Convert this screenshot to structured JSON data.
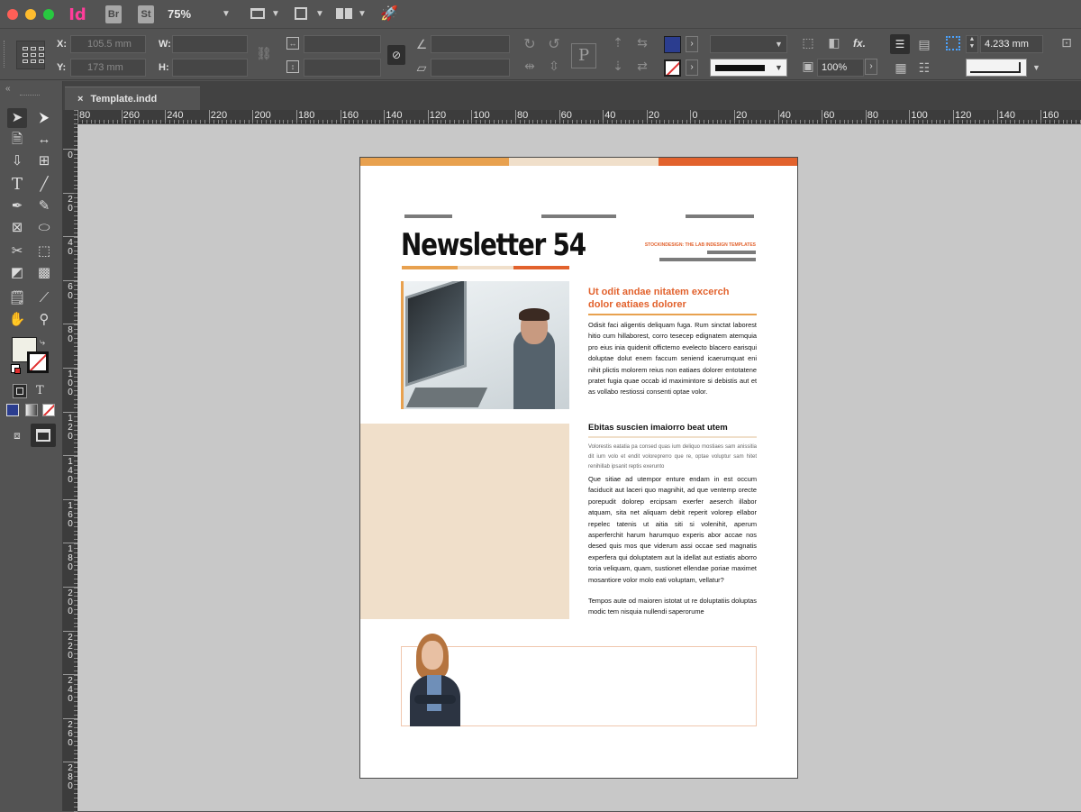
{
  "app": {
    "indesign_label": "Id",
    "bridge_label": "Br",
    "stock_label": "St",
    "zoom": "75%"
  },
  "control": {
    "x_label": "X:",
    "y_label": "Y:",
    "w_label": "W:",
    "h_label": "H:",
    "x_value": "105.5 mm",
    "y_value": "173 mm",
    "opacity": "100%",
    "stroke_weight": "4.233 mm",
    "fx_label": "fx.",
    "paragraph_icon": "P"
  },
  "tab": {
    "title": "Template.indd",
    "close_glyph": "×"
  },
  "ruler": {
    "h_labels": [
      "80",
      "260",
      "240",
      "220",
      "200",
      "180",
      "160",
      "140",
      "120",
      "100",
      "80",
      "60",
      "40",
      "20",
      "0",
      "20",
      "40",
      "60",
      "80",
      "100",
      "120",
      "140",
      "160"
    ],
    "v_labels": [
      "0",
      "20",
      "40",
      "60",
      "80",
      "100",
      "120",
      "140",
      "160",
      "180",
      "200",
      "220",
      "240",
      "260",
      "280"
    ]
  },
  "colors": {
    "fill_swatch": "#f0f0e6",
    "stroke_swatch": "#e03030",
    "accent_orange": "#e2622d",
    "accent_amber": "#e8a14f",
    "accent_beige": "#f0dfca",
    "control_swatch_blue": "#2b3d8f"
  },
  "newsletter": {
    "title": "Newsletter 54",
    "tagline": "STOCKINDESIGN: THE LAB INDESIGN TEMPLATES",
    "article1": {
      "heading": "Ut odit andae nitatem excerch dolor eatiaes dolorer",
      "body": "Odisit faci aligentis deliquam fuga. Rum sinctat laborest hitio cum hillaborest, corro tesecep edignatem atemquia pro eius inia quidenit offictemo evelecto blacero earisqui doluptae dolut enem faccum seniend icaerumquat eni nihit plictis molorem reius non eatiaes dolorer entotatene pratet fugia quae occab id maximintore si debistis aut et as vollabo restiossi consenti optae volor."
    },
    "article2": {
      "heading": "Ebitas suscien imaiorro beat utem",
      "intro": "Volorestis eatatia pa consed quas ium deliquo mostiaes sam anissitia dit ium volo et endit voloreprerro que re, optae voluptur sam hitet renihillab ipsanit reptis exerunto",
      "body1": "Que sitiae ad utempor enture endam in est occum faciducit aut laceri quo magnihit, ad que ventemp orecte porepudit dolorep ercipsam exerfer aeserch illabor atquam, sita net aliquam debit reperit volorep ellabor repelec tatenis ut aitia siti si volenihit, aperum asperferchit harum harumquo experis abor accae nos desed quis mos que viderum assi occae sed magnatis experfera qui doluptatem aut la idellat aut estiatis aborro toria veliquam, quam, sustionet ellendae poriae maximet mosantiore volor molo eati voluptam, vellatur?",
      "body2": "Tempos aute od maioren istotat ut re doluptatiis doluptas modic tem nisquia nullendi saperorume"
    }
  }
}
